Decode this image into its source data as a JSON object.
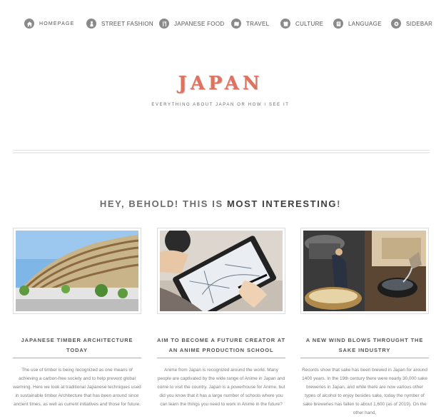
{
  "nav": {
    "items": [
      {
        "label": "Homepage",
        "icon": "home-icon"
      },
      {
        "label": "Street Fashion",
        "icon": "person-icon"
      },
      {
        "label": "Japanese Food",
        "icon": "utensils-icon"
      },
      {
        "label": "Travel",
        "icon": "map-icon"
      },
      {
        "label": "Culture",
        "icon": "culture-icon"
      },
      {
        "label": "Language",
        "icon": "language-icon"
      },
      {
        "label": "Sidebar",
        "icon": "gear-icon"
      }
    ]
  },
  "brand": {
    "title": "JAPAN",
    "subtitle": "Everything about Japan or how I see it",
    "accent_color": "#e0735f"
  },
  "headline": {
    "lead": "HEY, BEHOLD! THIS IS ",
    "emphasis": "MOST INTERESTING",
    "tail": "!"
  },
  "cards": [
    {
      "image": "timber-stadium-photo",
      "title": "Japanese Timber Architecture Today",
      "text": "The use of timber is being recognized as one means of achieving a carbon-free society and to help prevent global warming. Here we look at traditional Japanese techniques used in sustainable timber Architecture that has been around since ancient times, as well as current initiatives and those for future."
    },
    {
      "image": "anime-drawing-photo",
      "title": "Aim to Become a Future Creator at an Anime Production School",
      "text": "Anime from Japan is recognized around the world. Many people are captivated by the wide range of Anime in Japan and come to visit the country. Japan is a powerhouse for Anime, but did you know that it has a large number of schools where you can learn the things you need to work in Anime in the future?"
    },
    {
      "image": "sake-brewery-photo",
      "title": "A New Wind Blows Throught the Sake Industry",
      "text": "Records show that sake has been brewed in Japan for around 1400 years. In the 19th century there were nearly 30,000 sake breweries in Japan, and while there are now various other types of alcohol to enjoy besides sake, today the nymber of sake breweries has fallen to about 1,600 (as of 2019). On the other hand,"
    }
  ]
}
